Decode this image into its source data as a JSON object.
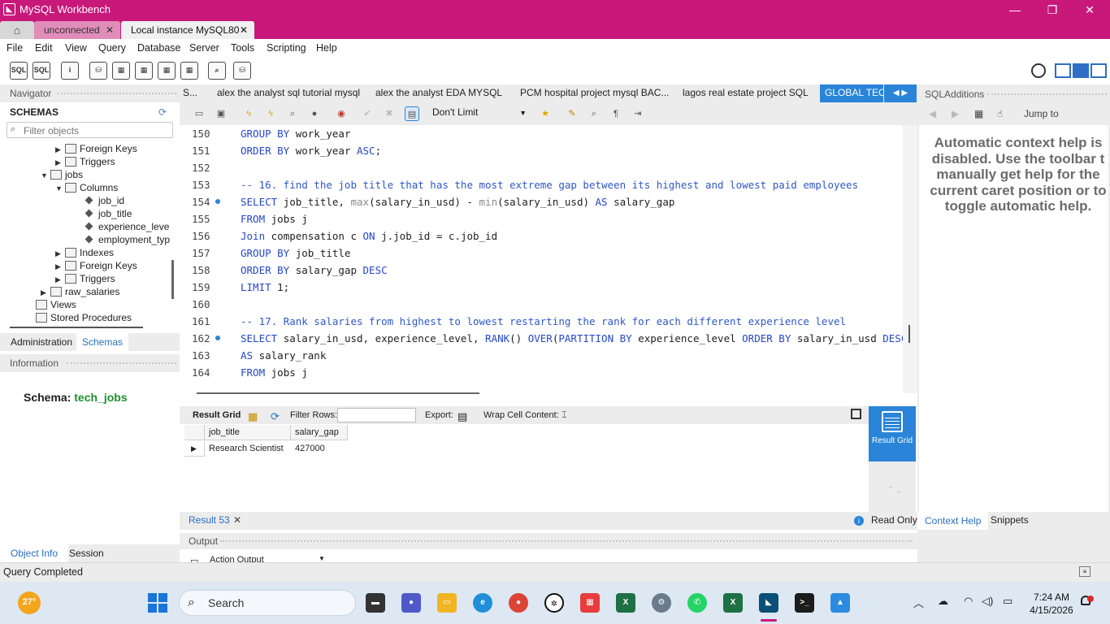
{
  "window": {
    "title": "MySQL Workbench",
    "min_glyph": "—",
    "max_glyph": "❐",
    "close_glyph": "✕"
  },
  "connection_tabs": [
    {
      "label": "unconnected",
      "close": "✕"
    },
    {
      "label": "Local instance MySQL80",
      "close": "✕"
    }
  ],
  "menu": [
    "File",
    "Edit",
    "View",
    "Query",
    "Database",
    "Server",
    "Tools",
    "Scripting",
    "Help"
  ],
  "navigator": {
    "header": "Navigator",
    "schemas_title": "SCHEMAS",
    "filter_placeholder": "Filter objects",
    "tree": [
      {
        "label": "Foreign Keys",
        "arrow": "▶"
      },
      {
        "label": "Triggers",
        "arrow": "▶"
      },
      {
        "label": "jobs",
        "arrow": "▼"
      },
      {
        "label": "Columns",
        "arrow": "▼"
      },
      {
        "label": "job_id"
      },
      {
        "label": "job_title"
      },
      {
        "label": "experience_leve"
      },
      {
        "label": "employment_typ"
      },
      {
        "label": "Indexes",
        "arrow": "▶"
      },
      {
        "label": "Foreign Keys",
        "arrow": "▶"
      },
      {
        "label": "Triggers",
        "arrow": "▶"
      },
      {
        "label": "raw_salaries",
        "arrow": "▶"
      },
      {
        "label": "Views"
      },
      {
        "label": "Stored Procedures"
      }
    ],
    "tabs": {
      "administration": "Administration",
      "schemas": "Schemas"
    },
    "information_header": "Information",
    "schema_label": "Schema:",
    "schema_value": "tech_jobs",
    "bottom_tabs": {
      "object_info": "Object Info",
      "session": "Session"
    }
  },
  "query_tabs": [
    "S...",
    "alex the analyst sql tutorial mysql",
    "alex the analyst EDA MYSQL",
    "PCM hospital project mysql BAC...",
    "lagos real estate project SQL",
    "GLOBAL TEC"
  ],
  "editor_toolbar": {
    "limit": "Don't Limit"
  },
  "code_lines": [
    {
      "n": "150",
      "parts": [
        [
          "kw",
          "GROUP BY "
        ],
        [
          "",
          "work_year"
        ]
      ]
    },
    {
      "n": "151",
      "parts": [
        [
          "kw",
          "ORDER BY "
        ],
        [
          "",
          "work_year "
        ],
        [
          "kw",
          "ASC"
        ],
        [
          "",
          ";"
        ]
      ]
    },
    {
      "n": "152",
      "parts": []
    },
    {
      "n": "153",
      "parts": [
        [
          "cm",
          "-- 16. find the job title that has the most extreme gap between its highest and lowest paid employees"
        ]
      ]
    },
    {
      "n": "154",
      "dot": true,
      "parts": [
        [
          "kw",
          "SELECT "
        ],
        [
          "",
          "job_title, "
        ],
        [
          "fn",
          "max"
        ],
        [
          "",
          "(salary_in_usd) - "
        ],
        [
          "fn",
          "min"
        ],
        [
          "",
          "(salary_in_usd) "
        ],
        [
          "kw",
          "AS "
        ],
        [
          "",
          "salary_gap"
        ]
      ]
    },
    {
      "n": "155",
      "parts": [
        [
          "kw",
          "FROM "
        ],
        [
          "",
          "jobs j"
        ]
      ]
    },
    {
      "n": "156",
      "parts": [
        [
          "kw",
          "Join "
        ],
        [
          "",
          "compensation c "
        ],
        [
          "kw",
          "ON "
        ],
        [
          "",
          "j.job_id = c.job_id"
        ]
      ]
    },
    {
      "n": "157",
      "parts": [
        [
          "kw",
          "GROUP BY "
        ],
        [
          "",
          "job_title"
        ]
      ]
    },
    {
      "n": "158",
      "parts": [
        [
          "kw",
          "ORDER BY "
        ],
        [
          "",
          "salary_gap "
        ],
        [
          "kw",
          "DESC"
        ]
      ]
    },
    {
      "n": "159",
      "parts": [
        [
          "kw",
          "LIMIT "
        ],
        [
          "",
          "1;"
        ]
      ]
    },
    {
      "n": "160",
      "parts": []
    },
    {
      "n": "161",
      "parts": [
        [
          "cm",
          "-- 17. Rank salaries from highest to lowest restarting the rank for each different experience level"
        ]
      ]
    },
    {
      "n": "162",
      "dot": true,
      "parts": [
        [
          "kw",
          "SELECT "
        ],
        [
          "",
          "salary_in_usd, experience_level, "
        ],
        [
          "kw",
          "RANK"
        ],
        [
          "",
          "() "
        ],
        [
          "kw",
          "OVER"
        ],
        [
          "",
          "("
        ],
        [
          "kw",
          "PARTITION BY "
        ],
        [
          "",
          "experience_level "
        ],
        [
          "kw",
          "ORDER BY "
        ],
        [
          "",
          "salary_in_usd "
        ],
        [
          "kw",
          "DESC"
        ],
        [
          "",
          ")"
        ]
      ]
    },
    {
      "n": "163",
      "parts": [
        [
          "kw",
          "AS "
        ],
        [
          "",
          "salary_rank"
        ]
      ]
    },
    {
      "n": "164",
      "parts": [
        [
          "kw",
          "FROM "
        ],
        [
          "",
          "jobs j"
        ]
      ]
    }
  ],
  "result": {
    "toolbar": {
      "result_grid": "Result Grid",
      "filter_rows": "Filter Rows:",
      "export": "Export:",
      "wrap": "Wrap Cell Content:"
    },
    "columns": [
      "job_title",
      "salary_gap"
    ],
    "rows": [
      [
        "Research Scientist",
        "427000"
      ]
    ],
    "side_label": "Result Grid",
    "tab": "Result 53",
    "read_only": "Read Only"
  },
  "output": {
    "header": "Output",
    "select": "Action Output"
  },
  "sql_additions": {
    "header": "SQLAdditions",
    "jump_to": "Jump to",
    "help_lines": [
      "Automatic context help is",
      "disabled. Use the toolbar t",
      "manually get help for the",
      "current caret position or to",
      "toggle automatic help."
    ],
    "tabs": {
      "context_help": "Context Help",
      "snippets": "Snippets"
    }
  },
  "status": "Query Completed",
  "taskbar": {
    "temperature": "27°",
    "search_placeholder": "Search",
    "time": "7:24 AM",
    "date": "4/15/2026"
  },
  "colors": {
    "title_bar": "#c8197b",
    "accent_blue": "#2a84d8",
    "keyword": "#2547c7",
    "schema_value": "#1e8f2f"
  }
}
